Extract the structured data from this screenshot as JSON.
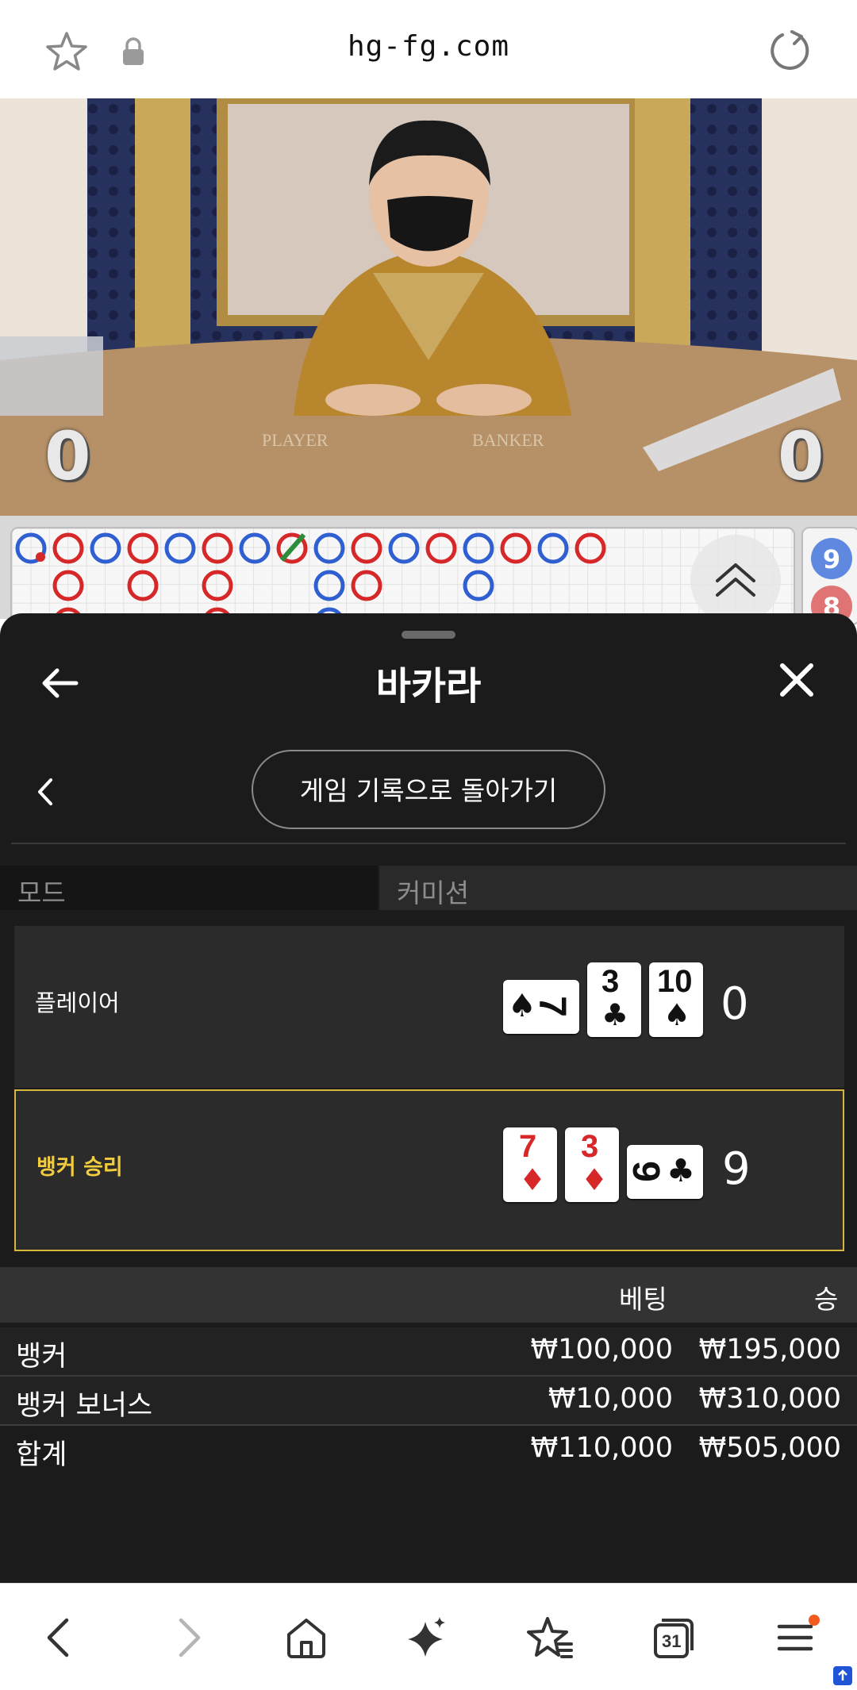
{
  "browser": {
    "url": "hg-fg.com",
    "icons": [
      "star-icon",
      "lock-icon",
      "reload-icon"
    ]
  },
  "video": {
    "player_score": "0",
    "banker_score": "0",
    "table_text_player": "PLAYER",
    "table_text_banker": "BANKER"
  },
  "roadmap": {
    "side_values": [
      "9",
      "8"
    ]
  },
  "sheet": {
    "title": "바카라",
    "return_label": "게임 기록으로 돌아가기",
    "mode_label": "모드",
    "mode_value": "커미션",
    "player": {
      "label": "플레이어",
      "total": "0",
      "cards": [
        {
          "rank": "7",
          "suit": "♠",
          "color": "black",
          "orientation": "rotated"
        },
        {
          "rank": "3",
          "suit": "♣",
          "color": "black",
          "orientation": "upright"
        },
        {
          "rank": "10",
          "suit": "♠",
          "color": "black",
          "orientation": "upright"
        }
      ]
    },
    "banker": {
      "label": "뱅커 승리",
      "total": "9",
      "cards": [
        {
          "rank": "7",
          "suit": "♦",
          "color": "red",
          "orientation": "upright"
        },
        {
          "rank": "3",
          "suit": "♦",
          "color": "red",
          "orientation": "upright"
        },
        {
          "rank": "9",
          "suit": "♣",
          "color": "black",
          "orientation": "rotated"
        }
      ]
    },
    "table": {
      "col_bet": "베팅",
      "col_win": "승",
      "rows": [
        {
          "name": "뱅커",
          "bet": "₩100,000",
          "win": "₩195,000"
        },
        {
          "name": "뱅커 보너스",
          "bet": "₩10,000",
          "win": "₩310,000"
        },
        {
          "name": "합계",
          "bet": "₩110,000",
          "win": "₩505,000"
        }
      ]
    }
  },
  "navbar": {
    "calendar_day": "31",
    "icons": [
      "back-icon",
      "forward-icon",
      "home-icon",
      "sparkle-icon",
      "bookmarks-icon",
      "tabs-icon",
      "menu-icon"
    ]
  },
  "colors": {
    "sheet_bg": "#1b1b1b",
    "winner_accent": "#f2cc3f",
    "banker_red": "#d62828",
    "player_blue": "#2f5fd0"
  }
}
